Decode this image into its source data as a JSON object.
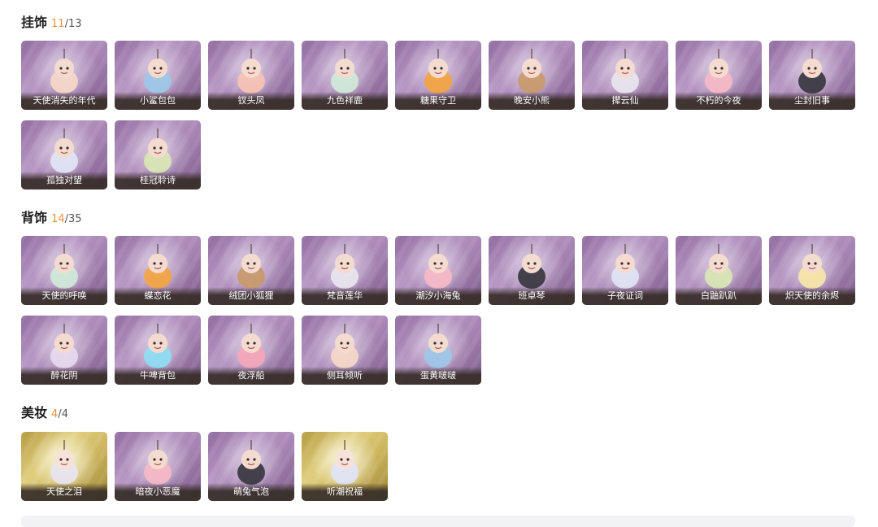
{
  "sections": [
    {
      "name": "挂饰",
      "owned": "11",
      "total": "13",
      "items": [
        {
          "label": "天使消失的年代",
          "icon": "angel-girl-pendant-icon",
          "theme": "purple"
        },
        {
          "label": "小鲨包包",
          "icon": "shark-pendant-icon",
          "theme": "purple"
        },
        {
          "label": "钗头凤",
          "icon": "phoenix-hairpin-icon",
          "theme": "purple"
        },
        {
          "label": "九色祥鹿",
          "icon": "deer-pendant-icon",
          "theme": "purple"
        },
        {
          "label": "糖果守卫",
          "icon": "pumpkin-pendant-icon",
          "theme": "purple"
        },
        {
          "label": "晚安小熊",
          "icon": "bear-pendant-icon",
          "theme": "purple"
        },
        {
          "label": "撵云仙",
          "icon": "cloud-fairy-pendant-icon",
          "theme": "purple"
        },
        {
          "label": "不朽的今夜",
          "icon": "cat-cake-pendant-icon",
          "theme": "purple"
        },
        {
          "label": "尘封旧事",
          "icon": "crowned-boy-pendant-icon",
          "theme": "purple"
        },
        {
          "label": "孤独对望",
          "icon": "lonely-girl-pendant-icon",
          "theme": "purple"
        },
        {
          "label": "桂冠聆诗",
          "icon": "laurel-girl-pendant-icon",
          "theme": "purple"
        }
      ]
    },
    {
      "name": "背饰",
      "owned": "14",
      "total": "35",
      "items": [
        {
          "label": "天使的呼唤",
          "icon": "angel-boy-back-icon",
          "theme": "purple"
        },
        {
          "label": "蝶恋花",
          "icon": "butterfly-lyre-back-icon",
          "theme": "purple"
        },
        {
          "label": "绒团小狐狸",
          "icon": "fox-back-icon",
          "theme": "purple"
        },
        {
          "label": "梵音莲华",
          "icon": "lotus-child-back-icon",
          "theme": "purple"
        },
        {
          "label": "潮汐小海兔",
          "icon": "sea-bunny-back-icon",
          "theme": "purple"
        },
        {
          "label": "班卓琴",
          "icon": "banjo-back-icon",
          "theme": "purple"
        },
        {
          "label": "子夜证词",
          "icon": "owl-witness-back-icon",
          "theme": "purple"
        },
        {
          "label": "白鼬趴趴",
          "icon": "white-weasel-back-icon",
          "theme": "purple"
        },
        {
          "label": "炽天使的余烬",
          "icon": "seraph-back-icon",
          "theme": "purple"
        },
        {
          "label": "醉花阴",
          "icon": "flower-wings-back-icon",
          "theme": "purple"
        },
        {
          "label": "牛啤背包",
          "icon": "cow-barrel-back-icon",
          "theme": "purple"
        },
        {
          "label": "夜浮船",
          "icon": "night-boat-back-icon",
          "theme": "purple"
        },
        {
          "label": "侧耳倾听",
          "icon": "lotus-ear-back-icon",
          "theme": "purple"
        },
        {
          "label": "蛋黄啵啵",
          "icon": "egg-chick-back-icon",
          "theme": "purple"
        }
      ]
    },
    {
      "name": "美妆",
      "owned": "4",
      "total": "4",
      "items": [
        {
          "label": "天使之泪",
          "icon": "angel-tear-makeup-icon",
          "theme": "gold"
        },
        {
          "label": "暗夜小恶魔",
          "icon": "little-devil-makeup-icon",
          "theme": "purple"
        },
        {
          "label": "萌兔气泡",
          "icon": "bunny-bubble-makeup-icon",
          "theme": "purple"
        },
        {
          "label": "听潮祝福",
          "icon": "tide-blessing-makeup-icon",
          "theme": "gold"
        }
      ]
    }
  ],
  "colors": {
    "owned_count": "#f0923a",
    "card_purple": "#a684b3",
    "card_gold": "#cfb860"
  }
}
